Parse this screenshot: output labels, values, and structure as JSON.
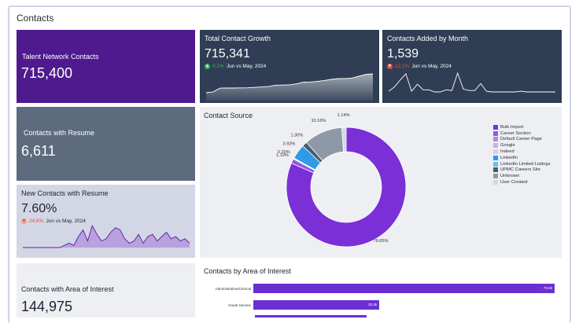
{
  "page": {
    "title": "Contacts"
  },
  "talent_network": {
    "label": "Talent Network Contacts",
    "value": "715,400"
  },
  "total_growth": {
    "label": "Total Contact Growth",
    "value": "715,341",
    "delta_pct": "0.2%",
    "delta_text": "Jun vs May, 2024",
    "delta_color": "#3fb96b"
  },
  "added_by_month": {
    "label": "Contacts Added by Month",
    "value": "1,539",
    "delta_pct": "12.1%",
    "delta_text": "Jun vs May, 2024",
    "delta_color": "#e0533d"
  },
  "with_resume": {
    "label": "Contacts with Resume",
    "value": "6,611"
  },
  "new_with_resume": {
    "label": "New Contacts with Resume",
    "value": "7.60%",
    "delta_pct": "24.8%",
    "delta_text": "Jun vs May, 2024",
    "delta_color": "#e0533d"
  },
  "area_of_interest": {
    "label": "Contacts with Area of Interest",
    "value": "144,975"
  },
  "chart_data": [
    {
      "type": "pie",
      "title": "Contact Source",
      "donut": true,
      "categories": [
        "Bulk Import",
        "Career Section",
        "Default Career Page",
        "Google",
        "Indeed",
        "LinkedIn",
        "LinkedIn Limited Listings",
        "UPMC Careers Site",
        "Unknown",
        "User Created"
      ],
      "values": [
        79.65,
        1.19,
        0.2,
        0.1,
        0.0,
        3.92,
        0.0,
        1.3,
        10.16,
        1.14
      ],
      "colors": [
        "#7b2fd6",
        "#8f5ae3",
        "#a98be8",
        "#c4b0ef",
        "#e9c6ef",
        "#2f9be6",
        "#64c2e8",
        "#4a5a6e",
        "#8e98a7",
        "#d4d8e1"
      ],
      "data_labels": [
        "79.65%",
        "1.19%",
        "0.20%",
        "",
        "",
        "3.92%",
        "",
        "1.30%",
        "10.16%",
        "1.14%"
      ],
      "legend_position": "right"
    },
    {
      "type": "bar",
      "title": "Contacts by Area of Interest",
      "categories": [
        "Administrative/Clerical",
        "Guest Service"
      ],
      "values": [
        79.6,
        33.3
      ],
      "value_labels": [
        "79.6k",
        "33.3k"
      ],
      "orientation": "horizontal"
    }
  ],
  "sparklines": {
    "total_growth": [
      100,
      128,
      250,
      254,
      255,
      258,
      262,
      275,
      290,
      303,
      345,
      350,
      360,
      390,
      445,
      450,
      470,
      500,
      535,
      560,
      565,
      580,
      640,
      700,
      715
    ],
    "added_by_month": [
      4,
      10,
      20,
      29,
      4,
      14,
      6,
      6,
      3,
      3,
      6,
      5,
      30,
      7,
      5,
      5,
      15,
      4,
      3,
      3,
      3,
      3,
      3,
      4,
      3,
      3,
      3,
      3,
      3,
      3
    ],
    "new_with_resume": [
      1,
      1,
      1,
      1,
      1,
      1,
      1,
      1,
      1,
      2,
      3,
      2,
      6,
      9,
      4,
      11,
      7,
      4,
      5,
      8,
      10,
      9,
      5,
      3,
      4,
      7,
      3,
      6,
      7,
      4,
      6,
      8,
      5,
      6,
      4,
      5,
      3
    ]
  }
}
